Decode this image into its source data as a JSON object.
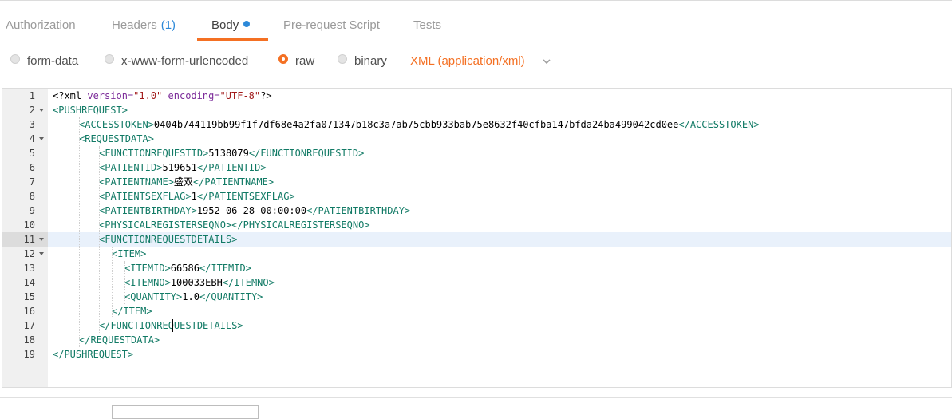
{
  "tabs": [
    {
      "label": "Authorization"
    },
    {
      "label": "Headers",
      "count": "(1)"
    },
    {
      "label": "Body",
      "active": true
    },
    {
      "label": "Pre-request Script"
    },
    {
      "label": "Tests"
    }
  ],
  "body_modes": [
    {
      "label": "form-data",
      "checked": false
    },
    {
      "label": "x-www-form-urlencoded",
      "checked": false
    },
    {
      "label": "raw",
      "checked": true
    },
    {
      "label": "binary",
      "checked": false
    }
  ],
  "content_type": "XML (application/xml)",
  "colors": {
    "accent": "#f47023",
    "blue": "#2b88d8",
    "tag": "#117a65"
  },
  "editor": {
    "active_line": 11,
    "lines": [
      {
        "n": "1",
        "fold": false,
        "indent": 0,
        "parts": [
          [
            "pi",
            "<?xml "
          ],
          [
            "attr",
            "version="
          ],
          [
            "str",
            "\"1.0\""
          ],
          [
            "pi",
            " "
          ],
          [
            "attr",
            "encoding="
          ],
          [
            "str",
            "\"UTF-8\""
          ],
          [
            "pi",
            "?>"
          ]
        ]
      },
      {
        "n": "2",
        "fold": true,
        "indent": 0,
        "parts": [
          [
            "tag",
            "<PUSHREQUEST>"
          ]
        ]
      },
      {
        "n": "3",
        "fold": false,
        "indent": 1,
        "parts": [
          [
            "tag",
            "<ACCESSTOKEN>"
          ],
          [
            "txt",
            "0404b744119bb99f1f7df68e4a2fa071347b18c3a7ab75cbb933bab75e8632f40cfba147bfda24ba499042cd0ee"
          ],
          [
            "tag",
            "</ACCESSTOKEN>"
          ]
        ]
      },
      {
        "n": "4",
        "fold": true,
        "indent": 1,
        "parts": [
          [
            "tag",
            "<REQUESTDATA>"
          ]
        ]
      },
      {
        "n": "5",
        "fold": false,
        "indent": 2,
        "parts": [
          [
            "tag",
            "<FUNCTIONREQUESTID>"
          ],
          [
            "txt",
            "5138079"
          ],
          [
            "tag",
            "</FUNCTIONREQUESTID>"
          ]
        ]
      },
      {
        "n": "6",
        "fold": false,
        "indent": 2,
        "parts": [
          [
            "tag",
            "<PATIENTID>"
          ],
          [
            "txt",
            "519651"
          ],
          [
            "tag",
            "</PATIENTID>"
          ]
        ]
      },
      {
        "n": "7",
        "fold": false,
        "indent": 2,
        "parts": [
          [
            "tag",
            "<PATIENTNAME>"
          ],
          [
            "txt",
            "盛双"
          ],
          [
            "tag",
            "</PATIENTNAME>"
          ]
        ]
      },
      {
        "n": "8",
        "fold": false,
        "indent": 2,
        "parts": [
          [
            "tag",
            "<PATIENTSEXFLAG>"
          ],
          [
            "txt",
            "1"
          ],
          [
            "tag",
            "</PATIENTSEXFLAG>"
          ]
        ]
      },
      {
        "n": "9",
        "fold": false,
        "indent": 2,
        "parts": [
          [
            "tag",
            "<PATIENTBIRTHDAY>"
          ],
          [
            "txt",
            "1952-06-28 00:00:00"
          ],
          [
            "tag",
            "</PATIENTBIRTHDAY>"
          ]
        ]
      },
      {
        "n": "10",
        "fold": false,
        "indent": 2,
        "parts": [
          [
            "tag",
            "<PHYSICALREGISTERSEQNO></PHYSICALREGISTERSEQNO>"
          ]
        ]
      },
      {
        "n": "11",
        "fold": true,
        "indent": 2,
        "parts": [
          [
            "tag",
            "<FUNCTIONREQUESTDETAILS>"
          ]
        ]
      },
      {
        "n": "12",
        "fold": true,
        "indent": 3,
        "parts": [
          [
            "tag",
            "<ITEM>"
          ]
        ]
      },
      {
        "n": "13",
        "fold": false,
        "indent": 4,
        "parts": [
          [
            "tag",
            "<ITEMID>"
          ],
          [
            "txt",
            "66586"
          ],
          [
            "tag",
            "</ITEMID>"
          ]
        ]
      },
      {
        "n": "14",
        "fold": false,
        "indent": 4,
        "parts": [
          [
            "tag",
            "<ITEMNO>"
          ],
          [
            "txt",
            "100033EBH"
          ],
          [
            "tag",
            "</ITEMNO>"
          ]
        ]
      },
      {
        "n": "15",
        "fold": false,
        "indent": 4,
        "parts": [
          [
            "tag",
            "<QUANTITY>"
          ],
          [
            "txt",
            "1.0"
          ],
          [
            "tag",
            "</QUANTITY>"
          ]
        ]
      },
      {
        "n": "16",
        "fold": false,
        "indent": 3,
        "parts": [
          [
            "tag",
            "</ITEM>"
          ]
        ]
      },
      {
        "n": "17",
        "fold": false,
        "indent": 2,
        "parts": [
          [
            "tag",
            "</FUNCTIONREQUESTDETAILS>"
          ]
        ]
      },
      {
        "n": "18",
        "fold": false,
        "indent": 1,
        "parts": [
          [
            "tag",
            "</REQUESTDATA>"
          ]
        ]
      },
      {
        "n": "19",
        "fold": false,
        "indent": 0,
        "parts": [
          [
            "tag",
            "</PUSHREQUEST>"
          ]
        ]
      }
    ]
  }
}
